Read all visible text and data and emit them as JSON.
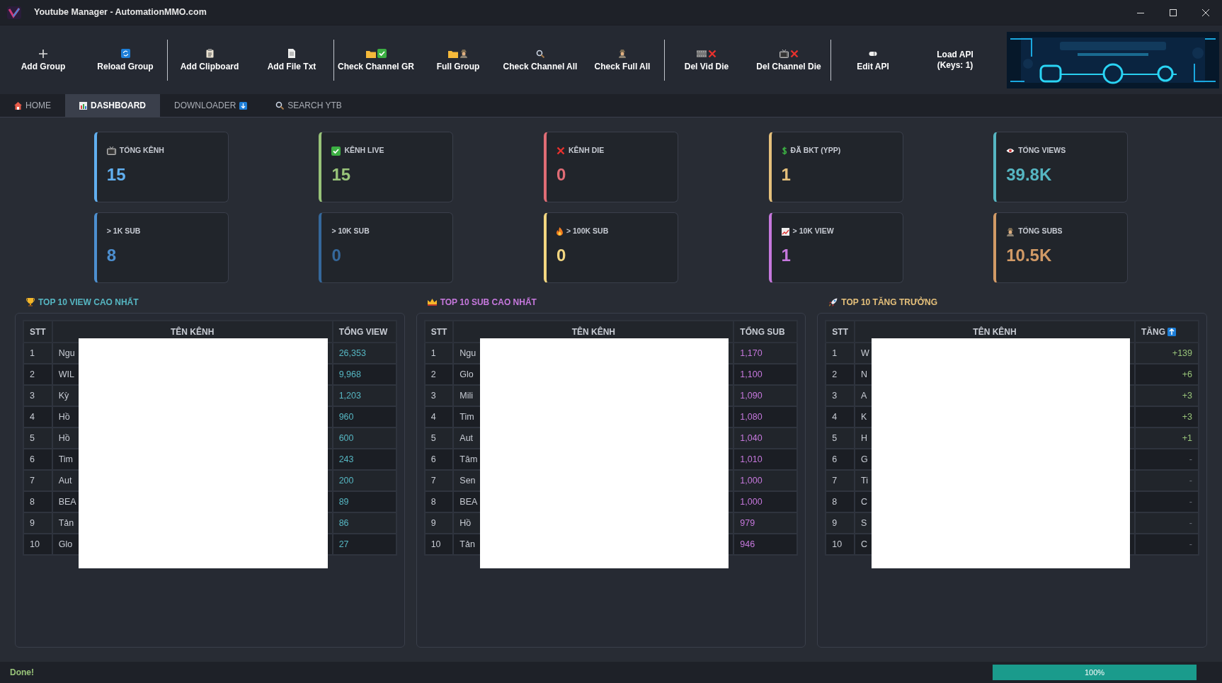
{
  "window": {
    "title": "Youtube Manager - AutomationMMO.com"
  },
  "toolbar": {
    "groups": [
      [
        {
          "label": "Add Group"
        },
        {
          "label": "Reload Group"
        }
      ],
      [
        {
          "label": "Add Clipboard"
        },
        {
          "label": "Add File Txt"
        }
      ],
      [
        {
          "label": "Check Channel GR"
        },
        {
          "label": "Full Group"
        },
        {
          "label": "Check Channel All"
        },
        {
          "label": "Check Full All"
        }
      ],
      [
        {
          "label": "Del Vid Die"
        },
        {
          "label": "Del Channel Die"
        }
      ],
      [
        {
          "label": "Edit API"
        },
        {
          "label": "Load API (Keys: 1)"
        }
      ]
    ]
  },
  "tabs": [
    {
      "label": "HOME",
      "selected": false
    },
    {
      "label": "DASHBOARD",
      "selected": true
    },
    {
      "label": "DOWNLOADER",
      "selected": false
    },
    {
      "label": "SEARCH YTB",
      "selected": false
    }
  ],
  "stats": [
    {
      "label": "TỔNG KÊNH",
      "value": "15",
      "color": "#61afef"
    },
    {
      "label": "KÊNH LIVE",
      "value": "15",
      "color": "#98c379"
    },
    {
      "label": "KÊNH DIE",
      "value": "0",
      "color": "#e06c75"
    },
    {
      "label": "ĐÃ BKT (YPP)",
      "value": "1",
      "color": "#e5c07b"
    },
    {
      "label": "TỔNG VIEWS",
      "value": "39.8K",
      "color": "#56b6c2"
    },
    {
      "label": "> 1K SUB",
      "value": "8",
      "color": "#4d8fcf"
    },
    {
      "label": "> 10K SUB",
      "value": "0",
      "color": "#35689b"
    },
    {
      "label": "> 100K SUB",
      "value": "0",
      "color": "#f2d680"
    },
    {
      "label": "> 10K VIEW",
      "value": "1",
      "color": "#c678dd"
    },
    {
      "label": "TỔNG SUBS",
      "value": "10.5K",
      "color": "#d19a66"
    }
  ],
  "tables": [
    {
      "title": "TOP 10 VIEW CAO NHẤT",
      "color": "#56b6c2",
      "redacted": true,
      "columns": [
        "STT",
        "TÊN KÊNH",
        "TỔNG VIEW"
      ],
      "rows": [
        {
          "stt": "1",
          "name": "Ngu",
          "value": "26,353",
          "kind": "value"
        },
        {
          "stt": "2",
          "name": "WIL",
          "value": "9,968",
          "kind": "value"
        },
        {
          "stt": "3",
          "name": "Kỳ",
          "value": "1,203",
          "kind": "value"
        },
        {
          "stt": "4",
          "name": "Hồ",
          "value": "960",
          "kind": "value"
        },
        {
          "stt": "5",
          "name": "Hồ",
          "value": "600",
          "kind": "value"
        },
        {
          "stt": "6",
          "name": "Tim",
          "value": "243",
          "kind": "value"
        },
        {
          "stt": "7",
          "name": "Aut",
          "value": "200",
          "kind": "value"
        },
        {
          "stt": "8",
          "name": "BEA",
          "value": "89",
          "kind": "value"
        },
        {
          "stt": "9",
          "name": "Tản",
          "value": "86",
          "kind": "value"
        },
        {
          "stt": "10",
          "name": "Glo",
          "value": "27",
          "kind": "value"
        }
      ]
    },
    {
      "title": "TOP 10 SUB CAO NHẤT",
      "color": "#c678dd",
      "redacted": true,
      "columns": [
        "STT",
        "TÊN KÊNH",
        "TỔNG SUB"
      ],
      "rows": [
        {
          "stt": "1",
          "name": "Ngu",
          "value": "1,170",
          "kind": "value"
        },
        {
          "stt": "2",
          "name": "Glo",
          "value": "1,100",
          "kind": "value"
        },
        {
          "stt": "3",
          "name": "Mili",
          "value": "1,090",
          "kind": "value"
        },
        {
          "stt": "4",
          "name": "Tim",
          "value": "1,080",
          "kind": "value"
        },
        {
          "stt": "5",
          "name": "Aut",
          "value": "1,040",
          "kind": "value"
        },
        {
          "stt": "6",
          "name": "Tâm",
          "value": "1,010",
          "kind": "value"
        },
        {
          "stt": "7",
          "name": "Sen",
          "value": "1,000",
          "kind": "value"
        },
        {
          "stt": "8",
          "name": "BEA",
          "value": "1,000",
          "kind": "value"
        },
        {
          "stt": "9",
          "name": "Hồ",
          "value": "979",
          "kind": "value"
        },
        {
          "stt": "10",
          "name": "Tản",
          "value": "946",
          "kind": "value"
        }
      ]
    },
    {
      "title": "TOP 10 TĂNG TRƯỞNG",
      "color": "#e5c07b",
      "redacted": true,
      "columns": [
        "STT",
        "TÊN KÊNH",
        "TĂNG"
      ],
      "rows": [
        {
          "stt": "1",
          "name": "W",
          "value": "+139",
          "kind": "gain"
        },
        {
          "stt": "2",
          "name": "N",
          "value": "+6",
          "kind": "gain"
        },
        {
          "stt": "3",
          "name": "A",
          "value": "+3",
          "kind": "gain"
        },
        {
          "stt": "4",
          "name": "K",
          "value": "+3",
          "kind": "gain"
        },
        {
          "stt": "5",
          "name": "H",
          "value": "+1",
          "kind": "gain"
        },
        {
          "stt": "6",
          "name": "G",
          "value": "-",
          "kind": "none"
        },
        {
          "stt": "7",
          "name": "Ti",
          "value": "-",
          "kind": "none"
        },
        {
          "stt": "8",
          "name": "C",
          "value": "-",
          "kind": "none"
        },
        {
          "stt": "9",
          "name": "S",
          "value": "-",
          "kind": "none"
        },
        {
          "stt": "10",
          "name": "C",
          "value": "-",
          "kind": "none"
        }
      ]
    }
  ],
  "status_bar": {
    "message": "Done!",
    "level": 1,
    "reading": "100%"
  }
}
